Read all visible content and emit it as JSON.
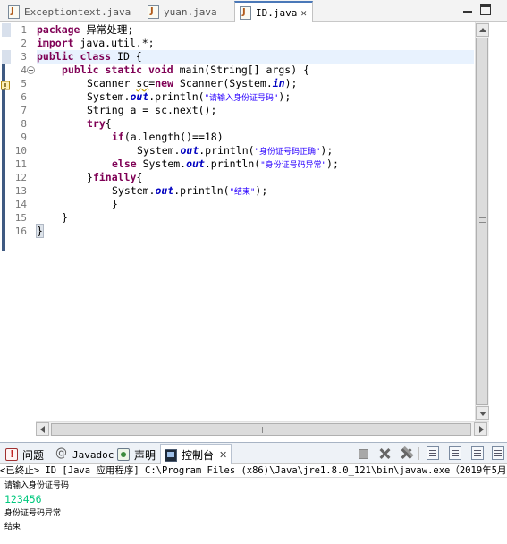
{
  "editor_tabs": [
    {
      "label": "Exceptiontext.java",
      "active": false
    },
    {
      "label": "yuan.java",
      "active": false
    },
    {
      "label": "ID.java",
      "active": true
    }
  ],
  "editor": {
    "line_numbers": [
      "1",
      "2",
      "3",
      "4",
      "5",
      "6",
      "7",
      "8",
      "9",
      "10",
      "11",
      "12",
      "13",
      "14",
      "15",
      "16"
    ],
    "code": {
      "l1_kw": "package",
      "l1_rest": " 异常处理;",
      "l2_kw": "import",
      "l2_rest": " java.util.*;",
      "l3_kw1": "public",
      "l3_kw2": "class",
      "l3_rest": " ID {",
      "l4_kw1": "public",
      "l4_kw2": "static",
      "l4_kw3": "void",
      "l4_rest": " main(String[] args) {",
      "l5_a": "Scanner ",
      "l5_var": "sc",
      "l5_b": "=",
      "l5_kw": "new",
      "l5_c": " Scanner(System.",
      "l5_field": "in",
      "l5_d": ");",
      "l6_a": "System.",
      "l6_field": "out",
      "l6_b": ".println(",
      "l6_str": "\"请输入身份证号码\"",
      "l6_c": ");",
      "l7_a": "String a = sc.next();",
      "l8_kw": "try",
      "l8_rest": "{",
      "l9_kw": "if",
      "l9_rest": "(a.length()==18)",
      "l10_a": "System.",
      "l10_field": "out",
      "l10_b": ".println(",
      "l10_str": "\"身份证号码正确\"",
      "l10_c": ");",
      "l11_kw": "else",
      "l11_a": " System.",
      "l11_field": "out",
      "l11_b": ".println(",
      "l11_str": "\"身份证号码异常\"",
      "l11_c": ");",
      "l12_a": "}",
      "l12_kw": "finally",
      "l12_b": "{",
      "l13_a": "System.",
      "l13_field": "out",
      "l13_b": ".println(",
      "l13_str": "\"结束\"",
      "l13_c": ");",
      "l14": "}",
      "l15": "}",
      "l16": "}"
    }
  },
  "view_tabs": [
    {
      "label": "问题",
      "icon": "problems-icon",
      "active": false
    },
    {
      "label": "Javadoc",
      "icon": "javadoc-icon",
      "active": false
    },
    {
      "label": "声明",
      "icon": "declaration-icon",
      "active": false
    },
    {
      "label": "控制台",
      "icon": "console-icon",
      "active": true
    }
  ],
  "console": {
    "header": "<已终止> ID [Java 应用程序] C:\\Program Files (x86)\\Java\\jre1.8.0_121\\bin\\javaw.exe（2019年5月1",
    "lines": [
      {
        "text": "请输入身份证号码",
        "kind": "output"
      },
      {
        "text": "123456",
        "kind": "input"
      },
      {
        "text": "身份证号码异常",
        "kind": "output"
      },
      {
        "text": "结束",
        "kind": "output"
      }
    ]
  },
  "colors": {
    "keyword": "#7f0055",
    "string": "#2a00ff",
    "static_field": "#0000c0",
    "console_input": "#00c87d",
    "current_line": "#e8f2fe"
  }
}
